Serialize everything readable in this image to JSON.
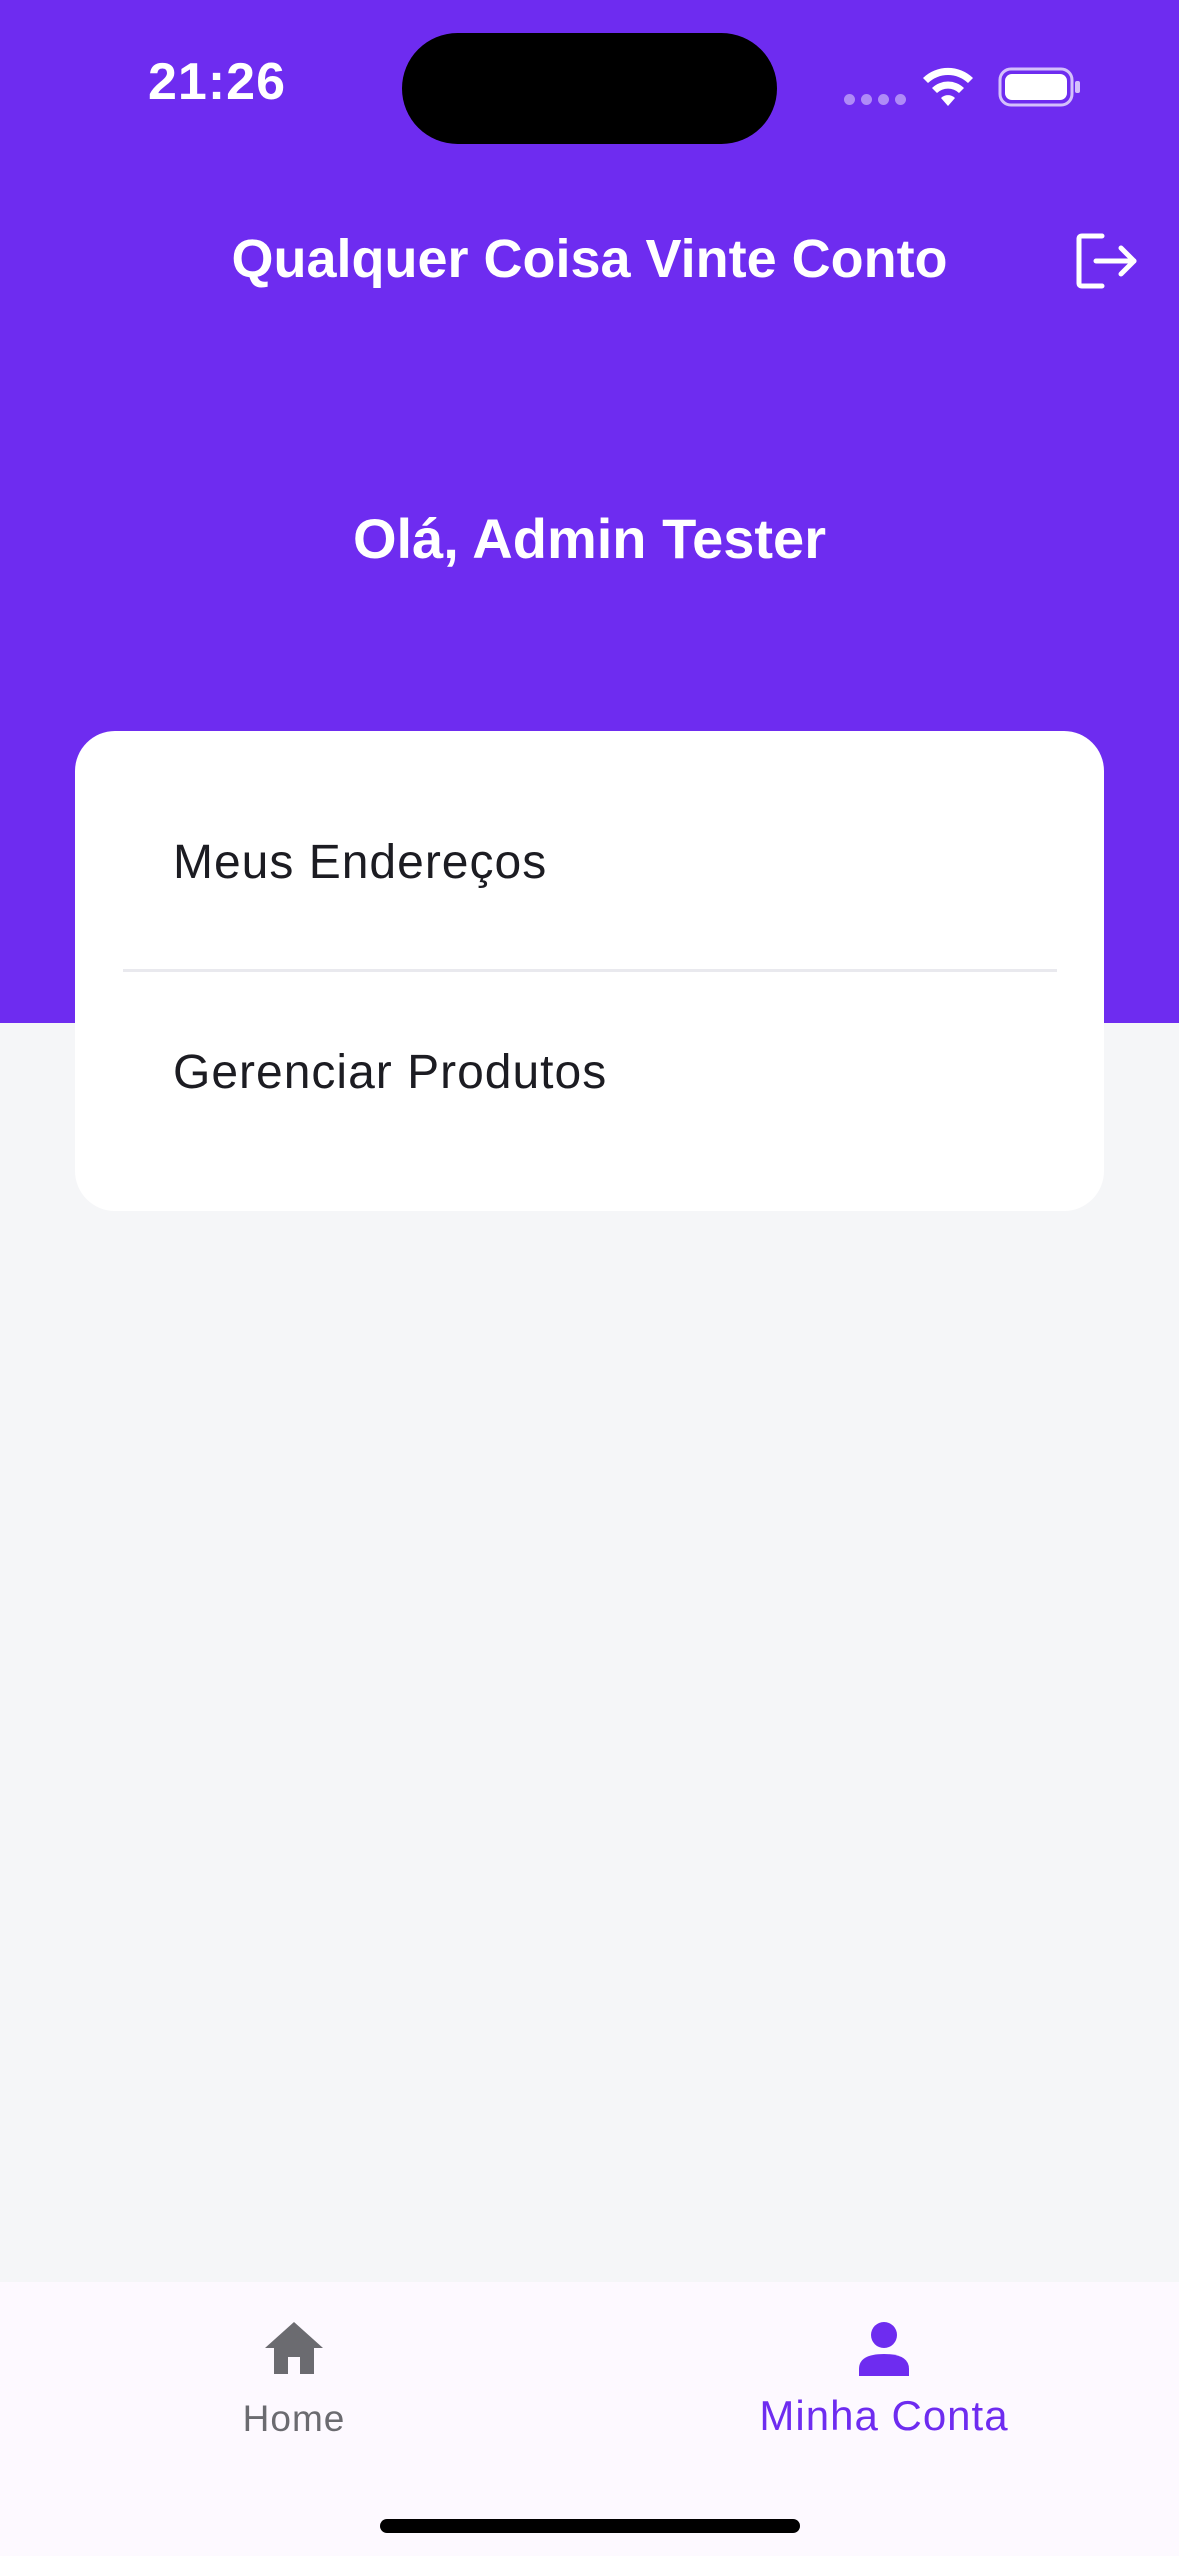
{
  "status_bar": {
    "time": "21:26"
  },
  "header": {
    "title": "Qualquer Coisa Vinte Conto",
    "logout_icon": "logout-icon"
  },
  "greeting": "Olá, Admin Tester",
  "menu": {
    "items": [
      {
        "label": "Meus Endereços"
      },
      {
        "label": "Gerenciar Produtos"
      }
    ]
  },
  "bottom_nav": {
    "items": [
      {
        "label": "Home",
        "icon": "home-icon",
        "active": false
      },
      {
        "label": "Minha Conta",
        "icon": "person-icon",
        "active": true
      }
    ]
  },
  "colors": {
    "primary": "#6e2cf0",
    "background": "#f5f6f8",
    "card": "#ffffff",
    "inactive": "#6b6b70"
  }
}
